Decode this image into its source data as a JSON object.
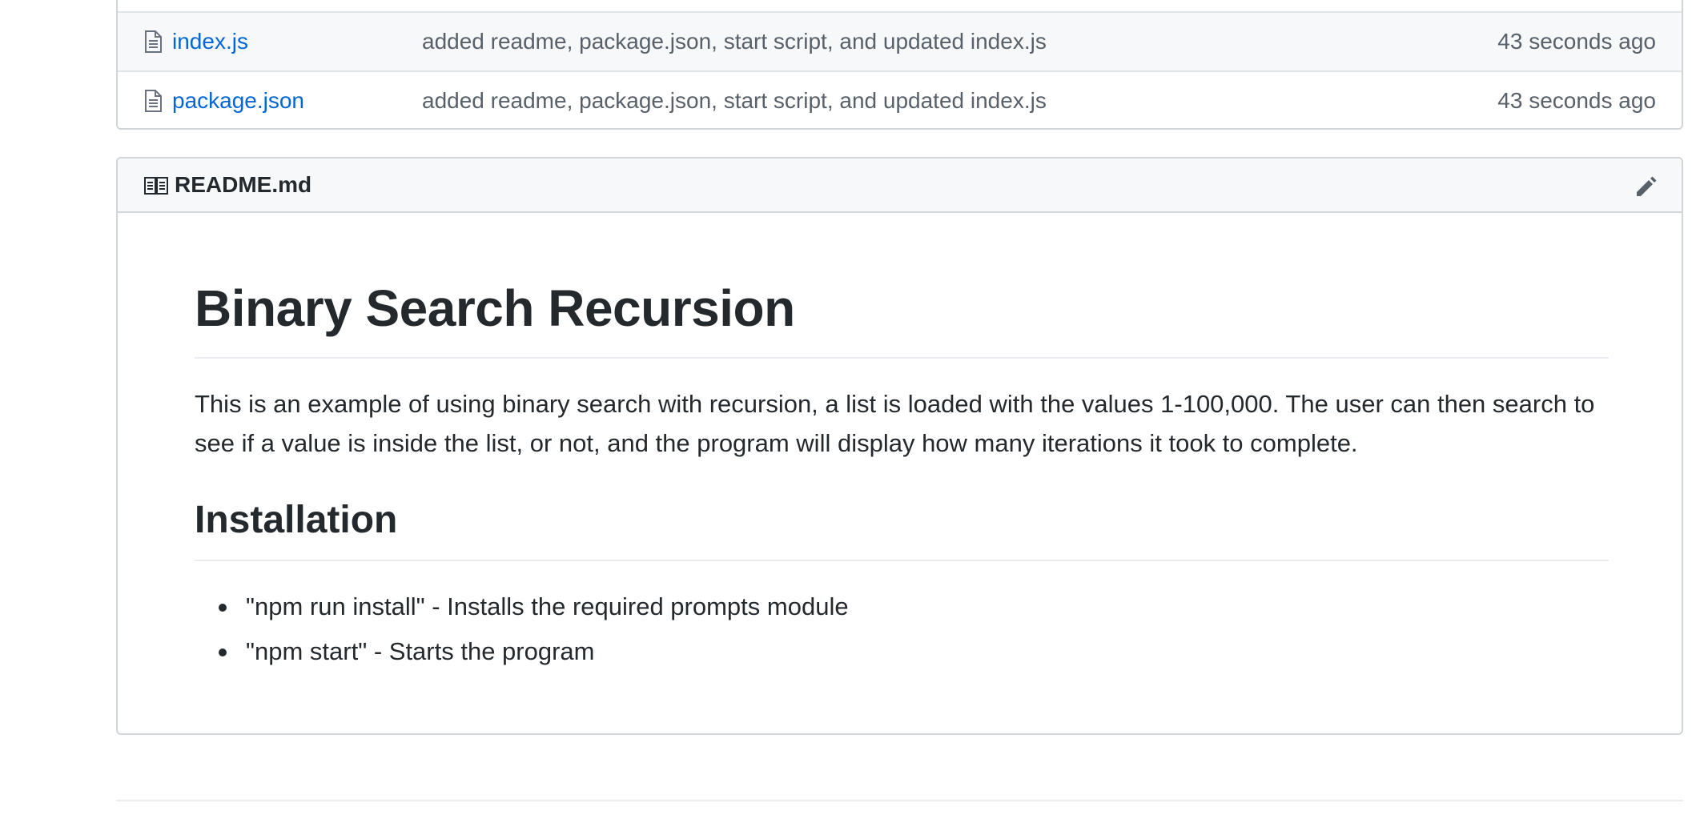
{
  "files": [
    {
      "name": "index.js",
      "icon": "file-icon",
      "commit_message": "added readme, package.json, start script, and updated index.js",
      "age": "43 seconds ago"
    },
    {
      "name": "package.json",
      "icon": "file-icon",
      "commit_message": "added readme, package.json, start script, and updated index.js",
      "age": "43 seconds ago"
    }
  ],
  "readme": {
    "filename": "README.md",
    "header_icon": "book-icon",
    "edit_icon": "pencil-icon",
    "title": "Binary Search Recursion",
    "description": "This is an example of using binary search with recursion, a list is loaded with the values 1-100,000. The user can then search to see if a value is inside the list, or not, and the program will display how many iterations it took to complete.",
    "installation_heading": "Installation",
    "installation_steps": [
      "\"npm run install\" - Installs the required prompts module",
      "\"npm start\" - Starts the program"
    ]
  },
  "colors": {
    "link": "#0366d6",
    "muted_text": "#586069",
    "text": "#24292e",
    "border": "#d1d5da",
    "header_bg": "#f6f8fa"
  }
}
